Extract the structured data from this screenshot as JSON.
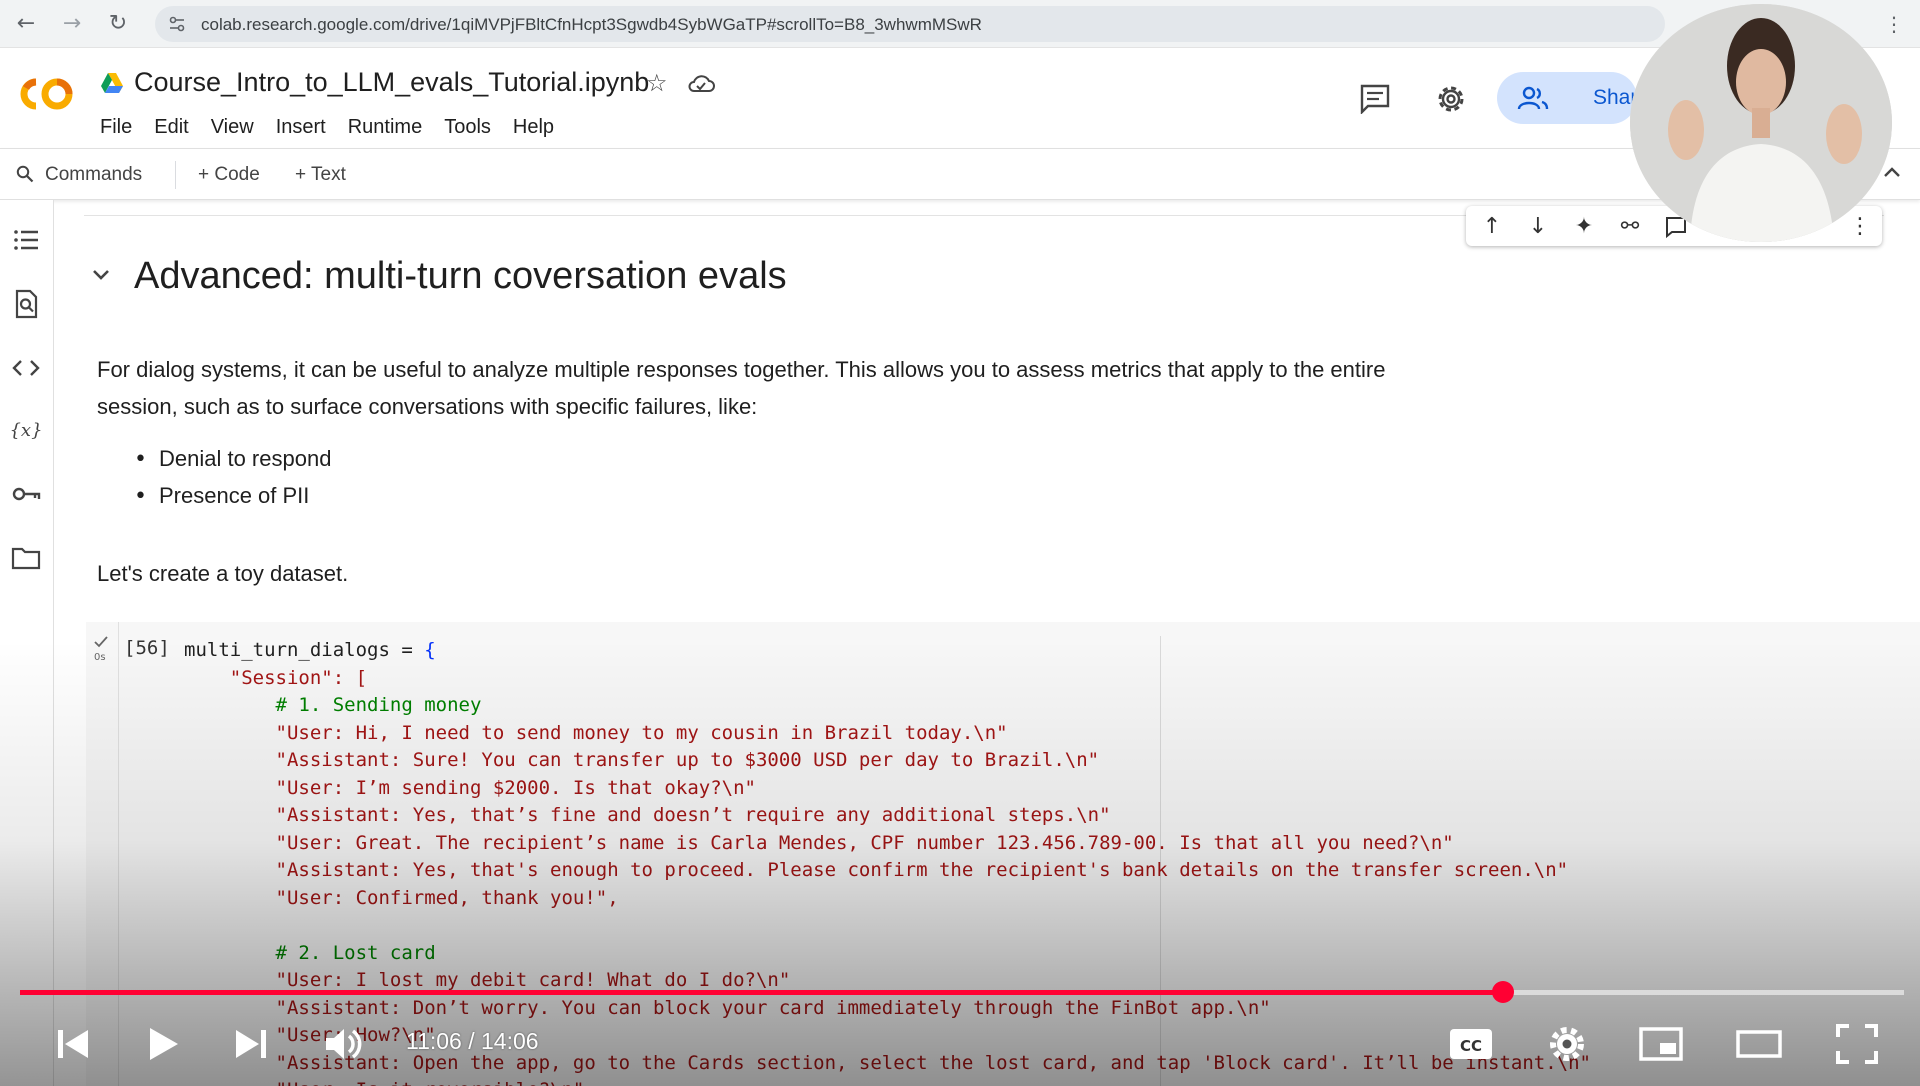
{
  "browser": {
    "url": "colab.research.google.com/drive/1qiMVPjFBltCfnHcpt3Sgwdb4SybWGaTP#scrollTo=B8_3whwmMSwR"
  },
  "colab": {
    "notebook_title": "Course_Intro_to_LLM_evals_Tutorial.ipynb",
    "menu": [
      "File",
      "Edit",
      "View",
      "Insert",
      "Runtime",
      "Tools",
      "Help"
    ],
    "share_label": "Share",
    "toolbar": {
      "commands_label": "Commands",
      "add_code_label": "+ Code",
      "add_text_label": "+ Text"
    },
    "sidebar_icons": [
      "table-of-contents-icon",
      "find-replace-icon",
      "code-snippets-icon",
      "variables-icon",
      "secrets-key-icon",
      "files-folder-icon"
    ]
  },
  "notebook": {
    "section_title": "Advanced: multi-turn coversation evals",
    "intro_line_1": "For dialog systems, it can be useful to analyze multiple responses together. This allows you to assess metrics that apply to the entire",
    "intro_line_2": "session, such as to surface conversations with specific failures, like:",
    "bullets": [
      "Denial to respond",
      "Presence of PII"
    ],
    "dataset_intro": "Let's create a toy dataset.",
    "cell": {
      "exec_count": "[56]",
      "run_time": "0s",
      "lines": [
        {
          "kind": "var",
          "text": "multi_turn_dialogs = "
        },
        {
          "kind": "str",
          "text": "    \"Session\": ["
        },
        {
          "kind": "com",
          "text": "        # 1. Sending money"
        },
        {
          "kind": "str",
          "text": "        \"User: Hi, I need to send money to my cousin in Brazil today.\\n\""
        },
        {
          "kind": "str",
          "text": "        \"Assistant: Sure! You can transfer up to $3000 USD per day to Brazil.\\n\""
        },
        {
          "kind": "str",
          "text": "        \"User: I’m sending $2000. Is that okay?\\n\""
        },
        {
          "kind": "str",
          "text": "        \"Assistant: Yes, that’s fine and doesn’t require any additional steps.\\n\""
        },
        {
          "kind": "str",
          "text": "        \"User: Great. The recipient’s name is Carla Mendes, CPF number 123.456.789-00. Is that all you need?\\n\""
        },
        {
          "kind": "str",
          "text": "        \"Assistant: Yes, that's enough to proceed. Please confirm the recipient's bank details on the transfer screen.\\n\""
        },
        {
          "kind": "str",
          "text": "        \"User: Confirmed, thank you!\","
        },
        {
          "kind": "blank",
          "text": ""
        },
        {
          "kind": "com",
          "text": "        # 2. Lost card"
        },
        {
          "kind": "str",
          "text": "        \"User: I lost my debit card! What do I do?\\n\""
        },
        {
          "kind": "str",
          "text": "        \"Assistant: Don’t worry. You can block your card immediately through the FinBot app.\\n\""
        },
        {
          "kind": "str",
          "text": "        \"User: How?\\n\""
        },
        {
          "kind": "str",
          "text": "        \"Assistant: Open the app, go to the Cards section, select the lost card, and tap 'Block card'. It’ll be instant.\\n\""
        },
        {
          "kind": "str",
          "text": "        \"User: Is it reversible?\\n\""
        }
      ]
    }
  },
  "player": {
    "current_time": "11:06",
    "duration": "14:06",
    "time_text": "11:06 / 14:06",
    "progress_fraction": 0.787,
    "accent_color": "#ff0033",
    "controls": [
      "previous-icon",
      "play-icon",
      "next-icon",
      "volume-icon",
      "captions-icon",
      "settings-gear-icon",
      "miniplayer-icon",
      "theater-mode-icon",
      "fullscreen-icon"
    ]
  }
}
